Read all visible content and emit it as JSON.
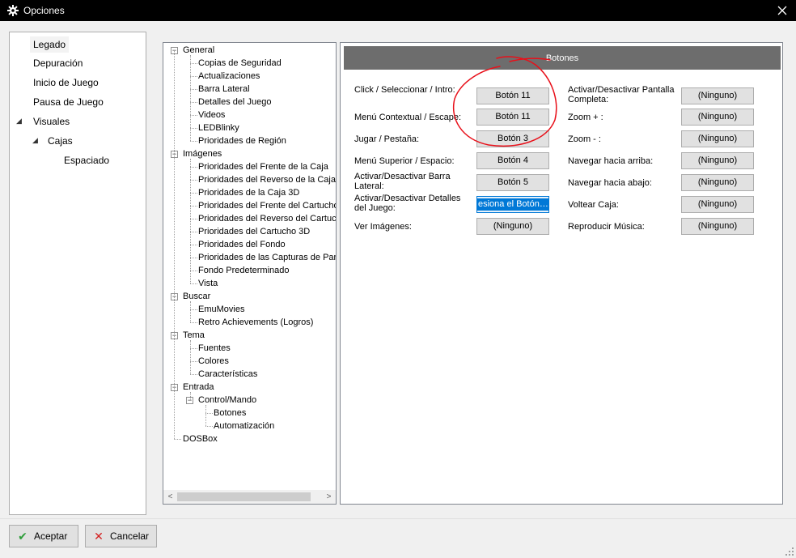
{
  "window": {
    "title": "Opciones",
    "icons": {
      "app": "gear-icon",
      "close": "close-icon"
    }
  },
  "left_nav": [
    {
      "label": "Legado",
      "selected": true
    },
    {
      "label": "Depuración"
    },
    {
      "label": "Inicio de Juego"
    },
    {
      "label": "Pausa de Juego"
    },
    {
      "label": "Visuales",
      "expanded": true
    },
    {
      "label": "Cajas",
      "expanded": true
    },
    {
      "label": "Espaciado"
    }
  ],
  "tree": [
    {
      "label": "General",
      "level": 0
    },
    {
      "label": "Copias de Seguridad",
      "level": 1
    },
    {
      "label": "Actualizaciones",
      "level": 1
    },
    {
      "label": "Barra Lateral",
      "level": 1
    },
    {
      "label": "Detalles del Juego",
      "level": 1
    },
    {
      "label": "Videos",
      "level": 1
    },
    {
      "label": "LEDBlinky",
      "level": 1
    },
    {
      "label": "Prioridades de Región",
      "level": 1
    },
    {
      "label": "Imágenes",
      "level": 0
    },
    {
      "label": "Prioridades del Frente de la Caja",
      "level": 1
    },
    {
      "label": "Prioridades del Reverso de la Caja",
      "level": 1
    },
    {
      "label": "Prioridades de la Caja 3D",
      "level": 1
    },
    {
      "label": "Prioridades del Frente del Cartucho",
      "level": 1
    },
    {
      "label": "Prioridades del Reverso del Cartucho",
      "level": 1
    },
    {
      "label": "Prioridades del Cartucho 3D",
      "level": 1
    },
    {
      "label": "Prioridades del Fondo",
      "level": 1
    },
    {
      "label": "Prioridades de las Capturas de Pantalla",
      "level": 1
    },
    {
      "label": "Fondo Predeterminado",
      "level": 1
    },
    {
      "label": "Vista",
      "level": 1
    },
    {
      "label": "Buscar",
      "level": 0
    },
    {
      "label": "EmuMovies",
      "level": 1
    },
    {
      "label": "Retro Achievements (Logros)",
      "level": 1
    },
    {
      "label": "Tema",
      "level": 0
    },
    {
      "label": "Fuentes",
      "level": 1
    },
    {
      "label": "Colores",
      "level": 1
    },
    {
      "label": "Características",
      "level": 1
    },
    {
      "label": "Entrada",
      "level": 0
    },
    {
      "label": "Control/Mando",
      "level": 1
    },
    {
      "label": "Botones",
      "level": 2,
      "selected": true
    },
    {
      "label": "Automatización",
      "level": 2
    },
    {
      "label": "DOSBox",
      "level": 0
    }
  ],
  "panel": {
    "header": "Botones",
    "left_fields": [
      {
        "label": "Click / Seleccionar / Intro:",
        "value": "Botón 11"
      },
      {
        "label": "Menú Contextual / Escape:",
        "value": "Botón 11"
      },
      {
        "label": "Jugar / Pestaña:",
        "value": "Botón 3"
      },
      {
        "label": "Menú Superior / Espacio:",
        "value": "Botón 4"
      },
      {
        "label": "Activar/Desactivar Barra Lateral:",
        "value": "Botón 5"
      },
      {
        "label": "Activar/Desactivar Detalles del Juego:",
        "value": "esiona el Botón…",
        "active": true
      },
      {
        "label": "Ver Imágenes:",
        "value": "(Ninguno)"
      }
    ],
    "right_fields": [
      {
        "label": "Activar/Desactivar Pantalla Completa:",
        "value": "(Ninguno)"
      },
      {
        "label": "Zoom + :",
        "value": "(Ninguno)"
      },
      {
        "label": "Zoom - :",
        "value": "(Ninguno)"
      },
      {
        "label": "Navegar hacia arriba:",
        "value": "(Ninguno)"
      },
      {
        "label": "Navegar hacia abajo:",
        "value": "(Ninguno)"
      },
      {
        "label": "Voltear Caja:",
        "value": "(Ninguno)"
      },
      {
        "label": "Reproducir Música:",
        "value": "(Ninguno)"
      }
    ]
  },
  "footer": {
    "accept": "Aceptar",
    "cancel": "Cancelar",
    "icons": {
      "accept": "checkmark-icon",
      "cancel": "x-icon"
    },
    "colors": {
      "accept_icon": "#2e9d3a",
      "cancel_icon": "#d42020"
    }
  },
  "annotation": {
    "color": "#e8101a"
  }
}
